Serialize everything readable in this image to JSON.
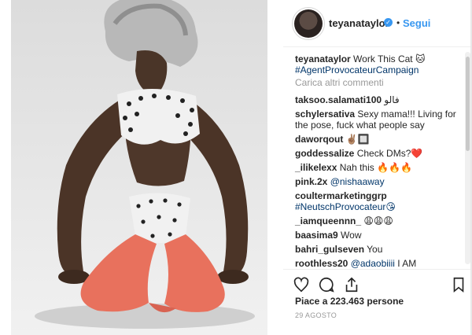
{
  "post": {
    "username": "teyanataylor",
    "verified_mark": "✓",
    "separator": "•",
    "follow_label": "Segui",
    "caption": {
      "username": "teyanataylor",
      "text": "Work This Cat 🐱",
      "hashtag": "#AgentProvocateurCampaign"
    },
    "load_more_label": "Carica altri commenti",
    "comments": [
      {
        "username": "taksoo.salamati100",
        "text": "فالو"
      },
      {
        "username": "schylersativa",
        "text": "Sexy mama!!! Living for the pose, fuck what people say"
      },
      {
        "username": "daworqout",
        "text": "✌🏽🔲"
      },
      {
        "username": "goddessalize",
        "text": "Check DMs?❤️"
      },
      {
        "username": "_ilikelexx",
        "text": "Nah this 🔥🔥🔥"
      },
      {
        "username": "pink.2x",
        "text": "",
        "mention": "@nishaaway"
      },
      {
        "username": "coultermarketinggrp",
        "text": "",
        "mention": "#NeutschProvocateur😘"
      },
      {
        "username": "_iamqueennn_",
        "text": "😩😩😩"
      },
      {
        "username": "baasima9",
        "text": "Wow"
      },
      {
        "username": "bahri_gulseven",
        "text": "You"
      },
      {
        "username": "roothless20",
        "text": "I AM",
        "mention": "@adaobiiii"
      }
    ],
    "likes_text": "Piace a 223.463 persone",
    "date_text": "29 AGOSTO",
    "icons": {
      "like": "heart-icon",
      "comment": "comment-icon",
      "share": "share-icon",
      "save": "bookmark-icon",
      "verified": "verified-badge-icon"
    },
    "colors": {
      "link": "#3897f0",
      "hashtag": "#003569",
      "muted": "#999999",
      "text": "#262626",
      "stockings": "#e8715d"
    }
  }
}
